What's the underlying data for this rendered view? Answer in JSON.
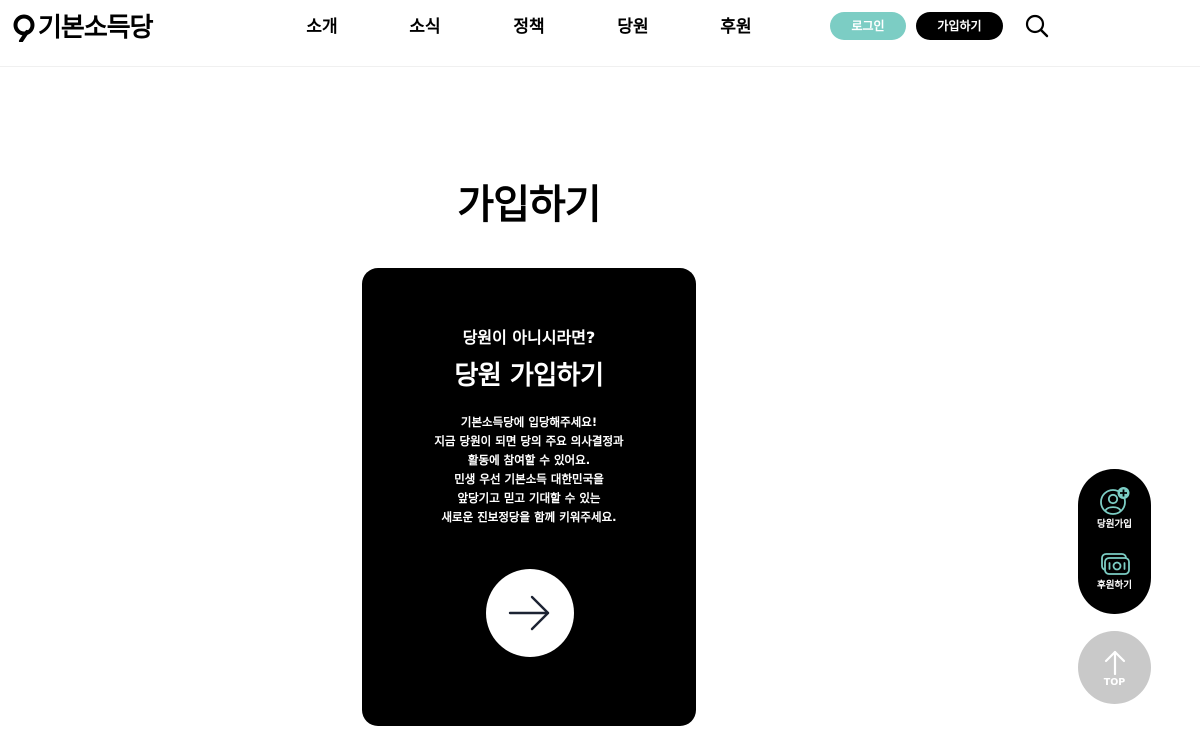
{
  "header": {
    "logo_text": "기본소득당",
    "nav": [
      "소개",
      "소식",
      "정책",
      "당원",
      "후원"
    ],
    "login_label": "로그인",
    "join_label": "가입하기"
  },
  "main": {
    "title": "가입하기",
    "card": {
      "eyebrow": "당원이 아니시라면?",
      "title": "당원 가입하기",
      "description": [
        "기본소득당에 입당해주세요!",
        "지금 당원이 되면 당의 주요 의사결정과",
        "활동에 참여할 수 있어요.",
        "민생 우선 기본소득 대한민국을",
        "앞당기고 믿고 기대할 수 있는",
        "새로운 진보정당을 함께 키워주세요."
      ]
    }
  },
  "floating": {
    "join_label": "당원가입",
    "donate_label": "후원하기",
    "top_label": "TOP"
  },
  "colors": {
    "login_button": "#7ccdc4",
    "dark": "#000000",
    "top_button": "#c9c9c9"
  },
  "icons": [
    "search-icon",
    "arrow-right-icon",
    "user-add-icon",
    "money-icon",
    "arrow-up-icon"
  ]
}
